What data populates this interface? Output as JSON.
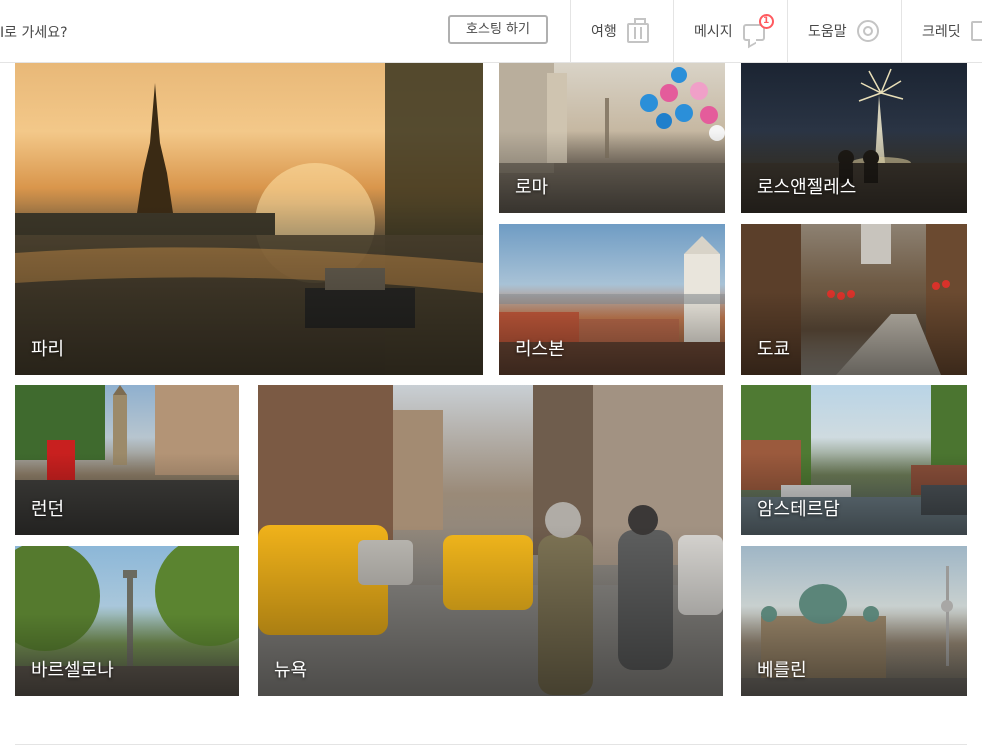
{
  "header": {
    "search_text": "I로 가세요?",
    "host_button": "호스팅 하기",
    "nav": [
      {
        "label": "여행",
        "icon": "suitcase-icon"
      },
      {
        "label": "메시지",
        "icon": "chat-icon",
        "badge": "1"
      },
      {
        "label": "도움말",
        "icon": "lifebuoy-icon"
      },
      {
        "label": "크레딧",
        "icon": "gift-icon"
      }
    ]
  },
  "cities": [
    {
      "name": "파리"
    },
    {
      "name": "로마"
    },
    {
      "name": "로스앤젤레스"
    },
    {
      "name": "리스본"
    },
    {
      "name": "도쿄"
    },
    {
      "name": "런던"
    },
    {
      "name": "뉴욕"
    },
    {
      "name": "암스테르담"
    },
    {
      "name": "바르셀로나"
    },
    {
      "name": "베를린"
    }
  ],
  "colors": {
    "accent": "#ff5a5f",
    "border": "#e4e4e4",
    "text": "#484848"
  }
}
